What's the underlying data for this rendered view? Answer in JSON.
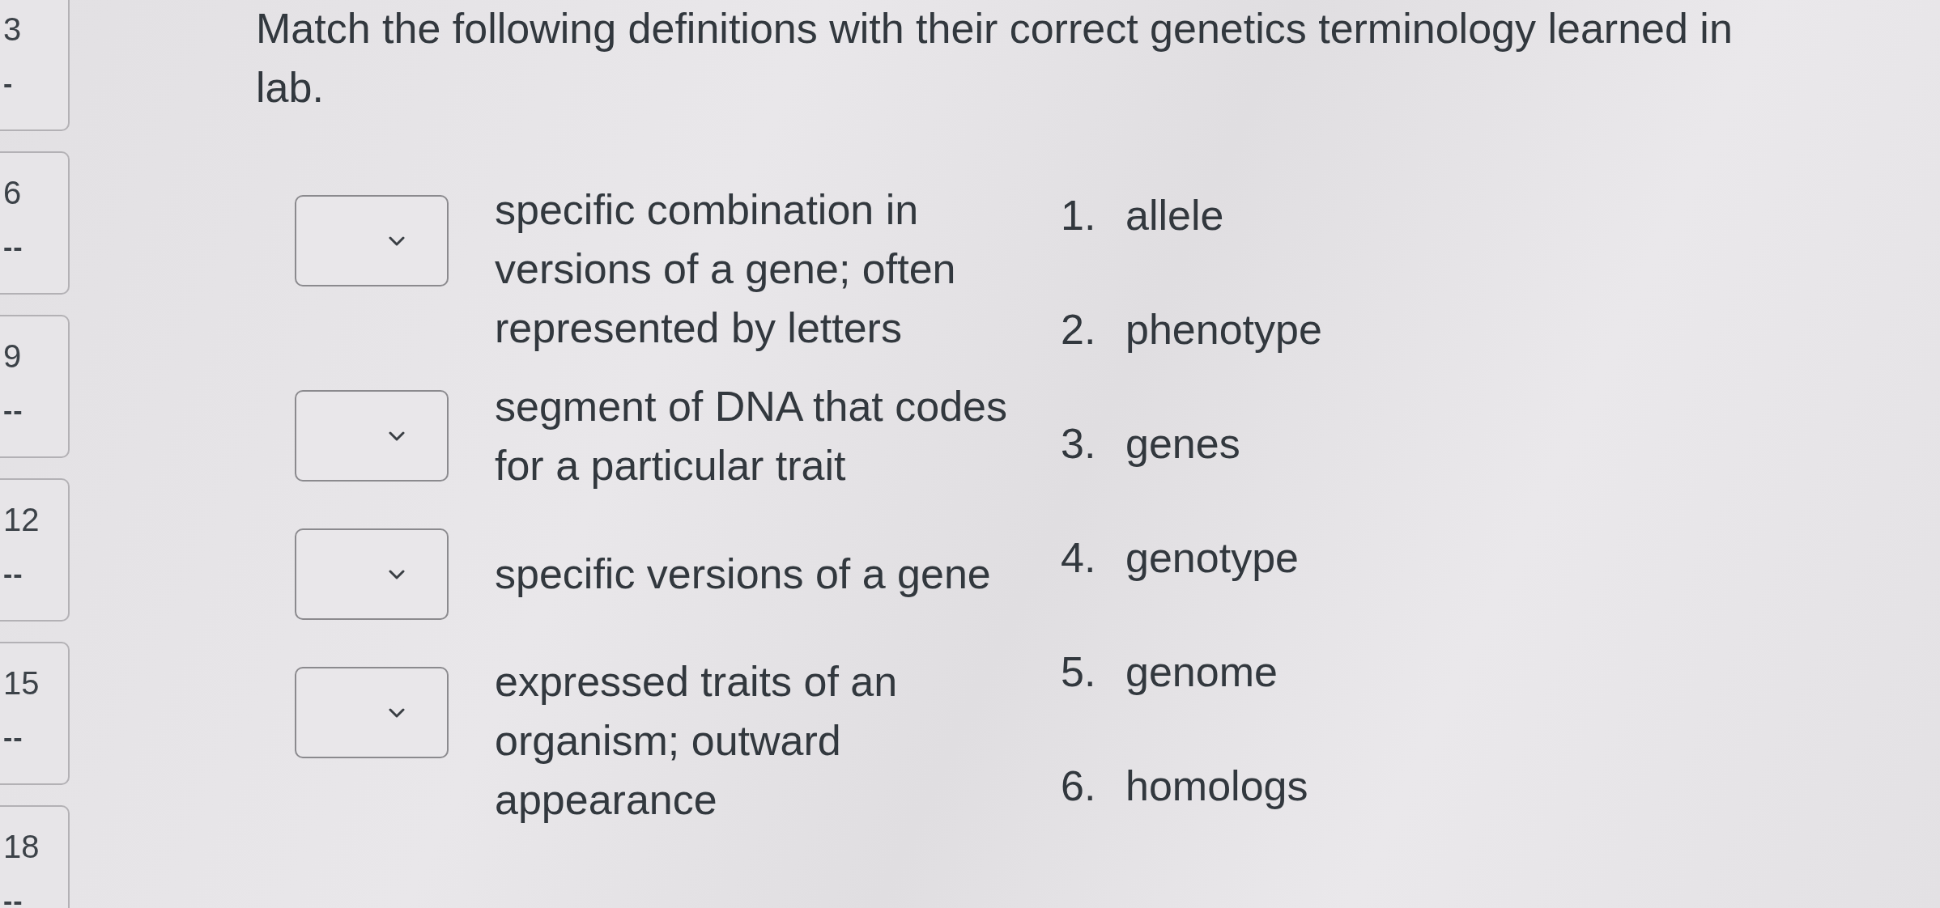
{
  "question_nav": [
    {
      "number": "3",
      "status": "-"
    },
    {
      "number": "6",
      "status": "--"
    },
    {
      "number": "9",
      "status": "--"
    },
    {
      "number": "12",
      "status": "--"
    },
    {
      "number": "15",
      "status": "--"
    },
    {
      "number": "18",
      "status": "--"
    }
  ],
  "question": {
    "prompt": "Match the following definitions with their correct genetics terminology learned in lab."
  },
  "matches": [
    {
      "definition": "specific combination in versions of a gene; often represented by letters"
    },
    {
      "definition": "segment of DNA that codes for a particular trait"
    },
    {
      "definition": "specific versions of a gene"
    },
    {
      "definition": "expressed traits of an organism; outward appearance"
    }
  ],
  "answers": [
    {
      "number": "1.",
      "term": "allele"
    },
    {
      "number": "2.",
      "term": "phenotype"
    },
    {
      "number": "3.",
      "term": "genes"
    },
    {
      "number": "4.",
      "term": "genotype"
    },
    {
      "number": "5.",
      "term": "genome"
    },
    {
      "number": "6.",
      "term": "homologs"
    }
  ]
}
